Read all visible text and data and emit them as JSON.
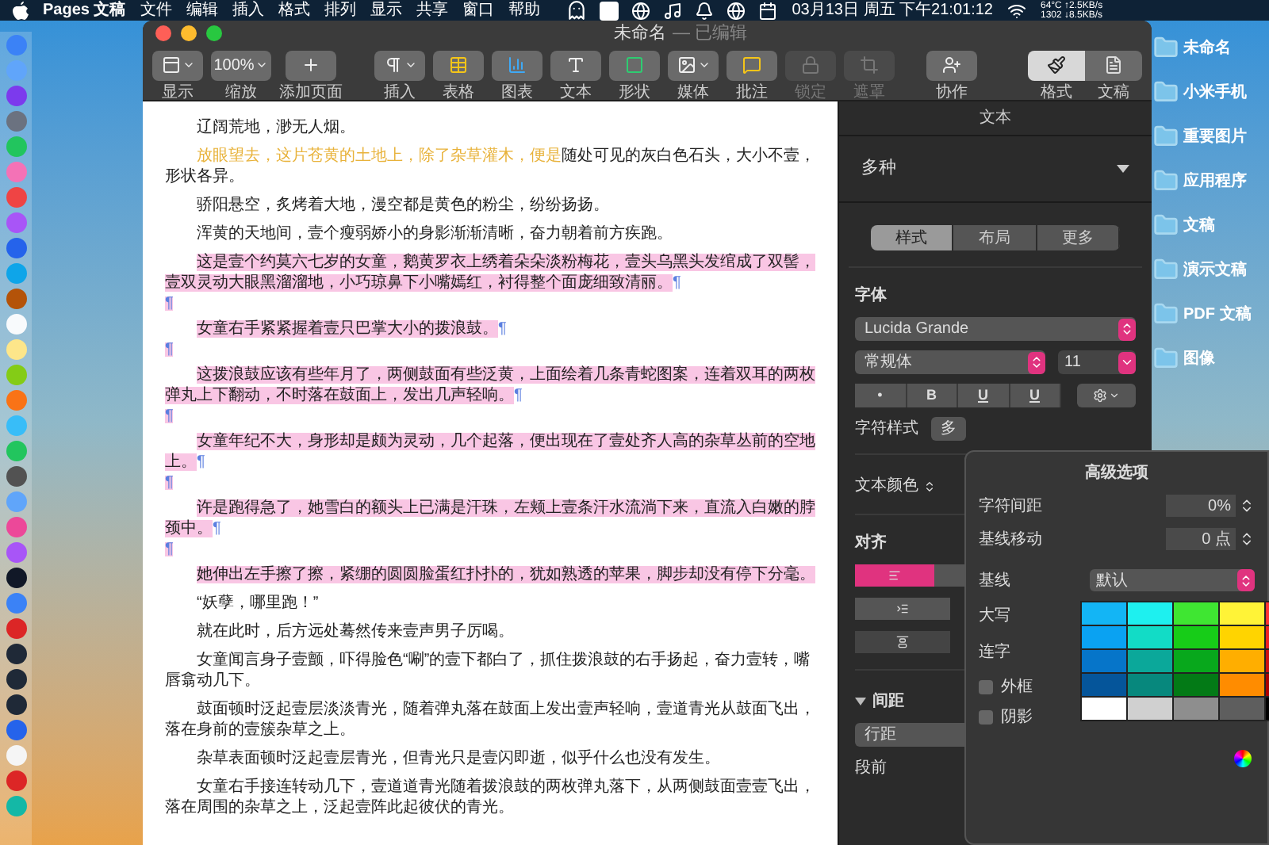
{
  "menu_bar": {
    "app_name": "Pages 文稿",
    "menus": [
      "文件",
      "编辑",
      "插入",
      "格式",
      "排列",
      "显示",
      "共享",
      "窗口",
      "帮助"
    ],
    "clock": "03月13日 周五 下午21:01:12",
    "net_stats": [
      "64°C ↑2.5KB/s",
      "1302 ↓8.5KB/s"
    ]
  },
  "window": {
    "title": "未命名",
    "subtitle": "— 已编辑"
  },
  "toolbar": [
    {
      "kind": "view",
      "label": "显示",
      "disabled": false
    },
    {
      "kind": "zoom",
      "label": "缩放",
      "value": "100%",
      "disabled": false
    },
    {
      "kind": "add_page",
      "label": "添加页面",
      "disabled": false
    },
    {
      "kind": "insert",
      "label": "插入",
      "disabled": false
    },
    {
      "kind": "table",
      "label": "表格",
      "disabled": false
    },
    {
      "kind": "chart",
      "label": "图表",
      "disabled": false
    },
    {
      "kind": "text",
      "label": "文本",
      "disabled": false
    },
    {
      "kind": "shape",
      "label": "形状",
      "disabled": false
    },
    {
      "kind": "media",
      "label": "媒体",
      "disabled": false
    },
    {
      "kind": "comment",
      "label": "批注",
      "disabled": false
    },
    {
      "kind": "lock",
      "label": "锁定",
      "disabled": true
    },
    {
      "kind": "mask",
      "label": "遮罩",
      "disabled": true
    },
    {
      "kind": "collaborate",
      "label": "协作",
      "disabled": false
    }
  ],
  "inspector_tabs": [
    {
      "kind": "format",
      "label": "格式",
      "selected": true
    },
    {
      "kind": "document",
      "label": "文稿",
      "selected": false
    }
  ],
  "document": {
    "paragraphs": [
      {
        "kind": "text",
        "highlight": false,
        "segments": [
          {
            "text": "辽阔荒地，渺无人烟。",
            "yellow": false
          }
        ]
      },
      {
        "kind": "text",
        "highlight": false,
        "segments": [
          {
            "text": "放眼望去，这片苍黄的土地上，除了杂草灌木，便是",
            "yellow": true
          },
          {
            "text": "随处可见的灰白色石头，大小不壹，形状各异。",
            "yellow": false
          }
        ]
      },
      {
        "kind": "text",
        "highlight": false,
        "segments": [
          {
            "text": "骄阳悬空，炙烤着大地，漫空都是黄色的粉尘，纷纷扬扬。",
            "yellow": false
          }
        ]
      },
      {
        "kind": "text",
        "highlight": false,
        "segments": [
          {
            "text": "浑黄的天地间，壹个瘦弱娇小的身影渐渐清晰，奋力朝着前方疾跑。",
            "yellow": false
          }
        ]
      },
      {
        "kind": "text",
        "highlight": true,
        "segments": [
          {
            "text": "这是壹个约莫六七岁的女童，鹅黄罗衣上绣着朵朵淡粉梅花，壹头乌黑头发绾成了双髻，壹双灵动大眼黑溜溜地，小巧琼鼻下小嘴嫣红，衬得整个面庞细致清丽。",
            "yellow": false
          }
        ],
        "end_mark": "¶"
      },
      {
        "kind": "empty",
        "end_mark": "¶"
      },
      {
        "kind": "text",
        "highlight": true,
        "segments": [
          {
            "text": "女童右手紧紧握着壹只巴掌大小的拨浪鼓。",
            "yellow": false
          }
        ],
        "end_mark": "¶"
      },
      {
        "kind": "empty",
        "end_mark": "¶"
      },
      {
        "kind": "text",
        "highlight": true,
        "segments": [
          {
            "text": "这拨浪鼓应该有些年月了，两侧鼓面有些泛黄，上面绘着几条青蛇图案，连着双耳的两枚弹丸上下翻动，不时落在鼓面上，发出几声轻响。",
            "yellow": false
          }
        ],
        "end_mark": "¶"
      },
      {
        "kind": "empty",
        "end_mark": "¶"
      },
      {
        "kind": "text",
        "highlight": true,
        "segments": [
          {
            "text": "女童年纪不大，身形却是颇为灵动，几个起落，便出现在了壹处齐人高的杂草丛前的空地上。",
            "yellow": false
          }
        ],
        "end_mark": "¶"
      },
      {
        "kind": "empty",
        "end_mark": "¶"
      },
      {
        "kind": "text",
        "highlight": true,
        "segments": [
          {
            "text": "许是跑得急了，她雪白的额头上已满是汗珠，左颊上壹条汗水流淌下来，直流入白嫩的脖颈中。",
            "yellow": false
          }
        ],
        "end_mark": "¶"
      },
      {
        "kind": "empty",
        "end_mark": "¶"
      },
      {
        "kind": "text",
        "highlight": true,
        "segments": [
          {
            "text": "她伸出左手擦了擦，紧绷的圆圆脸蛋红扑扑的，犹如熟透的苹果，脚步却没有停下分毫。",
            "yellow": false
          }
        ]
      },
      {
        "kind": "text",
        "highlight": false,
        "segments": [
          {
            "text": "“妖孽，哪里跑！”",
            "yellow": false
          }
        ]
      },
      {
        "kind": "text",
        "highlight": false,
        "segments": [
          {
            "text": "就在此时，后方远处蓦然传来壹声男子厉喝。",
            "yellow": false
          }
        ]
      },
      {
        "kind": "text",
        "highlight": false,
        "segments": [
          {
            "text": "女童闻言身子壹颤，吓得脸色“唰”的壹下都白了，抓住拨浪鼓的右手扬起，奋力壹转，嘴唇翕动几下。",
            "yellow": false
          }
        ]
      },
      {
        "kind": "text",
        "highlight": false,
        "segments": [
          {
            "text": "鼓面顿时泛起壹层淡淡青光，随着弹丸落在鼓面上发出壹声轻响，壹道青光从鼓面飞出，落在身前的壹簇杂草之上。",
            "yellow": false
          }
        ]
      },
      {
        "kind": "text",
        "highlight": false,
        "segments": [
          {
            "text": "杂草表面顿时泛起壹层青光，但青光只是壹闪即逝，似乎什么也没有发生。",
            "yellow": false
          }
        ]
      },
      {
        "kind": "text",
        "highlight": false,
        "segments": [
          {
            "text": "女童右手接连转动几下，壹道道青光随着拨浪鼓的两枚弹丸落下，从两侧鼓面壹壹飞出，落在周围的杂草之上，泛起壹阵此起彼伏的青光。",
            "yellow": false
          }
        ]
      }
    ]
  },
  "inspector": {
    "header": "文本",
    "paragraph_style": "多种",
    "tabs": [
      {
        "label": "样式",
        "selected": true
      },
      {
        "label": "布局",
        "selected": false
      },
      {
        "label": "更多",
        "selected": false
      }
    ],
    "font_label": "字体",
    "font_family": "Lucida Grande",
    "typeface": "常规体",
    "size": "11",
    "style_buttons": [
      {
        "kind": "plain",
        "label": "•"
      },
      {
        "kind": "bold",
        "label": "B"
      },
      {
        "kind": "underline",
        "label": "U"
      },
      {
        "kind": "underline",
        "label": "U"
      }
    ],
    "char_style_label": "字符样式",
    "char_style_value": "多",
    "text_color_label": "文本颜色",
    "align_label": "对齐",
    "align_buttons": [
      {
        "selected": true
      },
      {
        "selected": false
      }
    ],
    "spacing_label": "间距",
    "spacing_expanded": true,
    "line_spacing": "行距",
    "before_paragraph": "段前"
  },
  "popover": {
    "title": "高级选项",
    "rows": [
      {
        "kind": "stepper",
        "label": "字符间距",
        "value": "0%"
      },
      {
        "kind": "stepper",
        "label": "基线移动",
        "value": "0 点"
      },
      {
        "kind": "select",
        "label": "基线",
        "value": "默认"
      },
      {
        "kind": "plain",
        "label": "大写"
      },
      {
        "kind": "plain",
        "label": "连字"
      },
      {
        "kind": "checkbox",
        "label": "外框",
        "checked": false
      },
      {
        "kind": "checkbox",
        "label": "阴影",
        "checked": false
      }
    ]
  },
  "desktop_icons": [
    {
      "label": "未命名"
    },
    {
      "label": "小米手机"
    },
    {
      "label": "重要图片"
    },
    {
      "label": "应用程序"
    },
    {
      "label": "文稿"
    },
    {
      "label": "演示文稿"
    },
    {
      "label": "PDF 文稿"
    },
    {
      "label": "图像"
    }
  ]
}
